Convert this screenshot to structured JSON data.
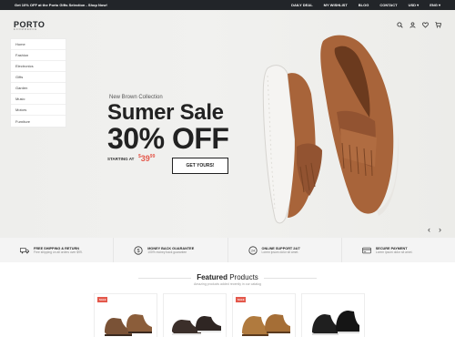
{
  "topbar": {
    "promo": "Get 10% OFF at the Porto Gifts Selection - Shop Now!",
    "links": [
      "DAILY DEAL",
      "MY WISHLIST",
      "BLOG",
      "CONTACT",
      "USD ▾",
      "ENG ▾"
    ]
  },
  "header": {
    "logo_text": "PORTO",
    "logo_sub": "ECOMMERCE",
    "icons": [
      "search-icon",
      "user-icon",
      "heart-icon",
      "cart-icon"
    ]
  },
  "sidebar": {
    "items": [
      "Home",
      "Fashion",
      "Electronics",
      "Gifts",
      "Garden",
      "Music",
      "Motors",
      "Furniture"
    ]
  },
  "hero": {
    "collection": "New Brown Collection",
    "title": "Sumer Sale",
    "offer": "30% OFF",
    "starting_label": "STARTING AT",
    "price_currency": "$",
    "price_whole": "39",
    "price_cents": "99",
    "cta_label": "GET YOURS!",
    "prev_label": "‹",
    "next_label": "›"
  },
  "features": [
    {
      "icon": "truck-icon",
      "title": "FREE SHIPPING & RETURN",
      "subtitle": "Free shipping on all orders over $99."
    },
    {
      "icon": "money-icon",
      "title": "MONEY BACK GUARANTEE",
      "subtitle": "100% money back guarantee"
    },
    {
      "icon": "support-icon",
      "title": "ONLINE SUPPORT 24/7",
      "subtitle": "Lorem ipsum dolor sit amet."
    },
    {
      "icon": "payment-icon",
      "title": "SECURE PAYMENT",
      "subtitle": "Lorem ipsum dolor sit amet."
    }
  ],
  "featured": {
    "title_bold": "Featured",
    "title_light": "Products",
    "subtitle": "Amazing products added recently in our catalog"
  },
  "products": [
    {
      "badge": "SALE"
    },
    {
      "badge": ""
    },
    {
      "badge": "SALE"
    },
    {
      "badge": ""
    }
  ],
  "colors": {
    "accent": "#e4584b",
    "dark": "#222529",
    "shoe_brown": "#a8643a"
  }
}
